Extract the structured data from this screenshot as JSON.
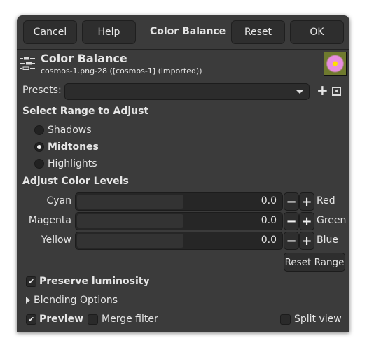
{
  "header": {
    "cancel": "Cancel",
    "help": "Help",
    "title": "Color Balance",
    "reset": "Reset",
    "ok": "OK"
  },
  "tool": {
    "title": "Color Balance",
    "subtitle": "cosmos-1.png-28 ([cosmos-1] (imported))",
    "icon": "color-balance-icon",
    "thumbnail": "cosmos-flower-thumbnail"
  },
  "presets": {
    "label": "Presets:",
    "value": ""
  },
  "range": {
    "heading": "Select Range to Adjust",
    "options": [
      "Shadows",
      "Midtones",
      "Highlights"
    ],
    "selected": "Midtones"
  },
  "levels": {
    "heading": "Adjust Color Levels",
    "rows": [
      {
        "left": "Cyan",
        "right": "Red",
        "value": "0.0"
      },
      {
        "left": "Magenta",
        "right": "Green",
        "value": "0.0"
      },
      {
        "left": "Yellow",
        "right": "Blue",
        "value": "0.0"
      }
    ],
    "reset_range": "Reset Range"
  },
  "preserve": {
    "label": "Preserve luminosity",
    "checked": true
  },
  "blending": {
    "label": "Blending Options"
  },
  "footer": {
    "preview": "Preview",
    "preview_checked": true,
    "merge": "Merge filter",
    "merge_checked": false,
    "split": "Split view",
    "split_checked": false
  }
}
